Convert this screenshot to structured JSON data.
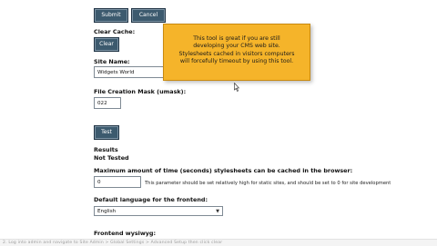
{
  "form": {
    "submit_label": "Submit",
    "cancel_label": "Cancel",
    "clear_cache_label": "Clear Cache:",
    "clear_button": "Clear",
    "site_name_label": "Site Name:",
    "site_name_value": "Widgets World",
    "file_mask_label": "File Creation Mask (umask):",
    "file_mask_value": "022",
    "test_button": "Test",
    "results_label": "Results",
    "results_value": "Not Tested",
    "max_time_label": "Maximum amount of time (seconds) stylesheets can be cached in the browser:",
    "max_time_value": "0",
    "max_time_hint": "This parameter should be set relatively high for static sites, and should be set to 0 for site development",
    "default_lang_label": "Default language for the frontend:",
    "default_lang_value": "English",
    "frontend_wysiwyg_label": "Frontend wysiwyg:"
  },
  "tooltip": {
    "line1": "This tool is great if you are still",
    "line2": "developing your CMS web site.",
    "line3": "Stylesheets cached in visitors computers",
    "line4": "will forcefully timeout by using this tool."
  },
  "footer": {
    "faded_text": "2. Log into admin and navigate to Site Admin > Global Settings > Advanced Setup then click clear"
  },
  "colors": {
    "button_bg": "#3c5a6e",
    "tooltip_bg": "#f5b42a"
  }
}
